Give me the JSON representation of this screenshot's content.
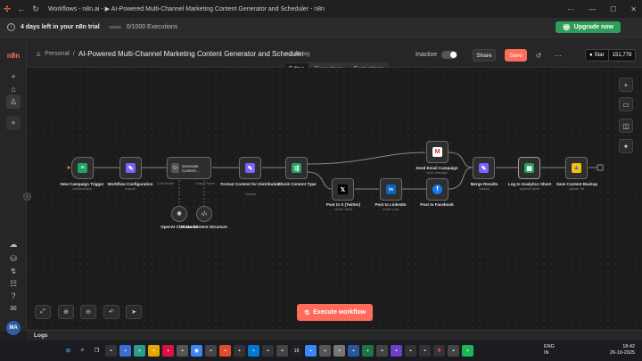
{
  "browser": {
    "tab_title": "Workflows - n8n.ai - ▶ AI-Powered Multi-Channel Marketing Content Generator and Scheduler - n8n"
  },
  "trial": {
    "days_left": "4 days left in your n8n trial",
    "executions": "0/1000 Executions",
    "executions_used_fraction": 0,
    "upgrade_label": "Upgrade now"
  },
  "header": {
    "breadcrumb": "Personal",
    "workflow_title": "AI-Powered Multi-Channel Marketing Content Generator and Scheduler",
    "add_tag": "+ Add tag",
    "status_label": "Inactive",
    "share_label": "Share",
    "save_label": "Save",
    "star_label": "Star",
    "star_count": "151,778"
  },
  "tabs": [
    "Editor",
    "Executions",
    "Evaluations"
  ],
  "nodes": {
    "new_campaign": {
      "label": "New Campaign Trigger",
      "sub": "onSubmission"
    },
    "workflow_config": {
      "label": "Workflow Configuration",
      "sub": "manual"
    },
    "generate": {
      "label": "Generate Content...",
      "sub_left": "Chat Model*",
      "sub_right": "Output Parser"
    },
    "openai": {
      "label": "OpenAI Chat Model"
    },
    "parse": {
      "label": "Parse Content Structure"
    },
    "format": {
      "label": "Format Content for Distribution",
      "sub": "manual"
    },
    "check": {
      "label": "Check Content Type"
    },
    "email": {
      "label": "Send Email Campaign",
      "sub": "send: message"
    },
    "twitter": {
      "label": "Post to X (Twitter)",
      "sub": "create: tweet"
    },
    "linkedin": {
      "label": "Post to LinkedIn",
      "sub": "create: post"
    },
    "facebook": {
      "label": "Post to Facebook"
    },
    "merge": {
      "label": "Merge Results",
      "sub": "manual"
    },
    "log": {
      "label": "Log to Analytics Sheet",
      "sub": "append: sheet"
    },
    "backup": {
      "label": "Save Content Backup",
      "sub": "upload: file"
    }
  },
  "canvas": {
    "execute_label": "Execute workflow"
  },
  "logs_label": "Logs",
  "taskbar": {
    "lang": "ENG",
    "region": "IN",
    "time": "18:42",
    "date": "26-10-2025",
    "badge": "19"
  },
  "colors": {
    "accent": "#ff6d5a",
    "upgrade": "#2f9e58",
    "sheets": "#1fa463",
    "workflow_icon": "#7b61ff",
    "linkedin": "#0a66c2",
    "facebook": "#1877f2"
  }
}
